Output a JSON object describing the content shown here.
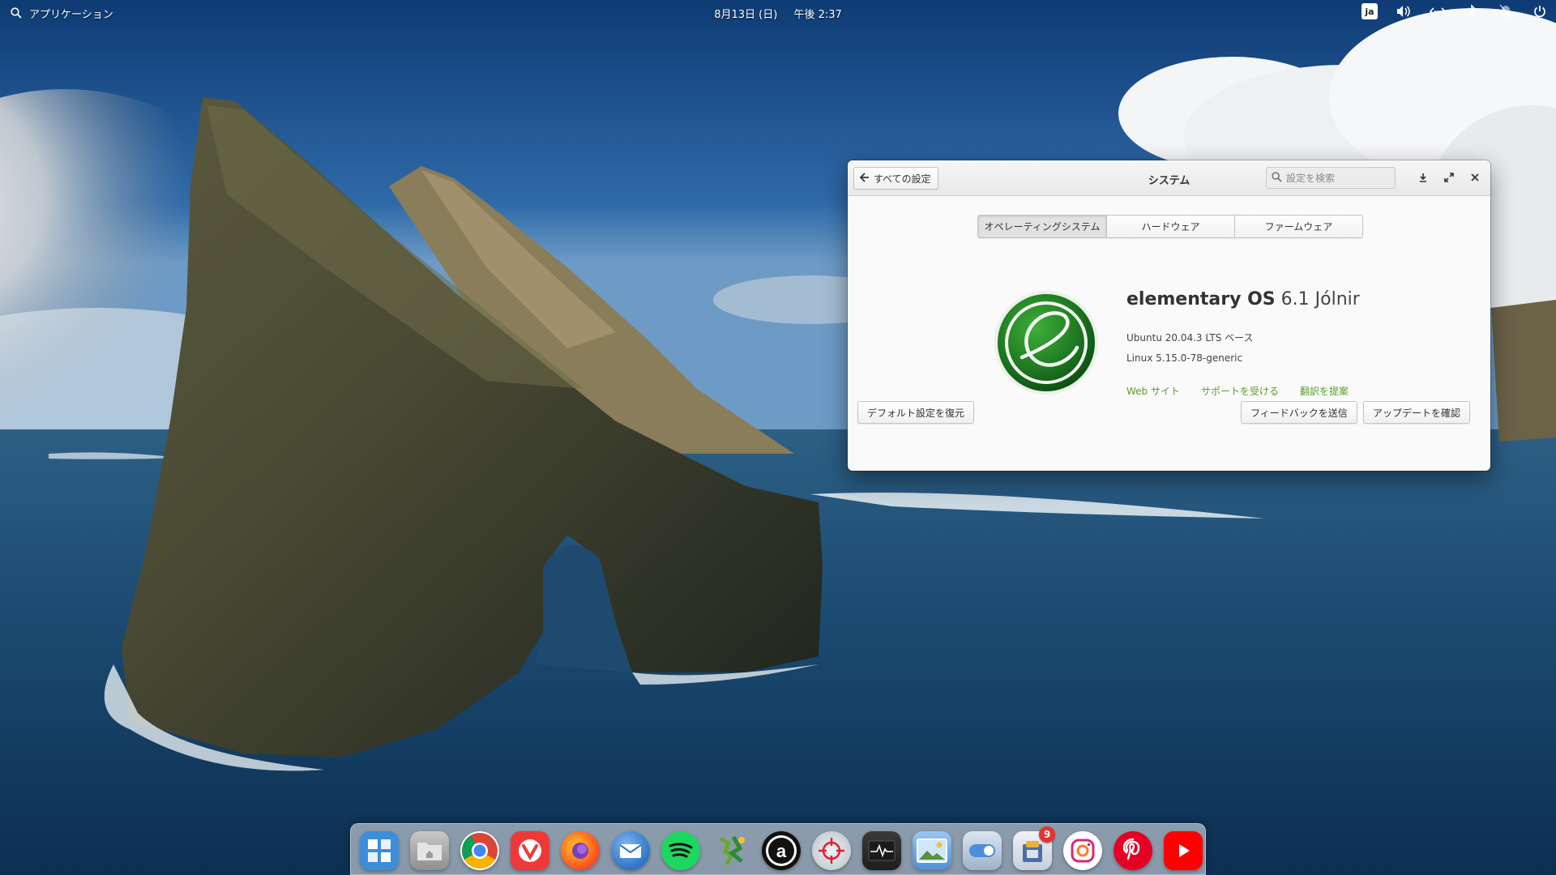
{
  "panel": {
    "apps_label": "アプリケーション",
    "date": "8月13日 (日)",
    "time": "午後 2:37",
    "lang": "ja",
    "icons": [
      "volume-icon",
      "network-icon",
      "bluetooth-icon",
      "notifications-icon",
      "power-icon"
    ]
  },
  "window": {
    "back_label": "すべての設定",
    "title": "システム",
    "search_placeholder": "設定を検索",
    "tabs": [
      {
        "label": "オペレーティングシステム",
        "active": true
      },
      {
        "label": "ハードウェア",
        "active": false
      },
      {
        "label": "ファームウェア",
        "active": false
      }
    ],
    "os_name": "elementary OS",
    "os_version": "6.1 Jólnir",
    "os_base": "Ubuntu 20.04.3 LTS ベース",
    "kernel": "Linux 5.15.0-78-generic",
    "links": [
      "Web サイト",
      "サポートを受ける",
      "翻訳を提案"
    ],
    "restore_label": "デフォルト設定を復元",
    "feedback_label": "フィードバックを送信",
    "update_label": "アップデートを確認"
  },
  "dock": {
    "apps": [
      {
        "name": "multitasking-view-icon",
        "color": "#3d8ed8"
      },
      {
        "name": "files-icon",
        "color": "#9a9a9a"
      },
      {
        "name": "chrome-icon",
        "color": "#ffffff"
      },
      {
        "name": "vivaldi-icon",
        "color": "#ef3939"
      },
      {
        "name": "firefox-icon",
        "color": "#ff7a18"
      },
      {
        "name": "thunderbird-icon",
        "color": "#2f74c6"
      },
      {
        "name": "spotify-icon",
        "color": "#1ed760"
      },
      {
        "name": "mahjong-icon",
        "color": "#6aa829"
      },
      {
        "name": "amazon-icon",
        "color": "#111111"
      },
      {
        "name": "screenshot-icon",
        "color": "#c9ced6"
      },
      {
        "name": "system-monitor-icon",
        "color": "#2b2b2b"
      },
      {
        "name": "photos-icon",
        "color": "#6aa8e2"
      },
      {
        "name": "settings-icon",
        "color": "#8fa5bf"
      },
      {
        "name": "appcenter-icon",
        "color": "#4a6fa5",
        "badge": "9"
      },
      {
        "name": "instagram-icon",
        "color": "#ffffff"
      },
      {
        "name": "pinterest-icon",
        "color": "#e60023"
      },
      {
        "name": "youtube-icon",
        "color": "#ff0000"
      }
    ]
  }
}
